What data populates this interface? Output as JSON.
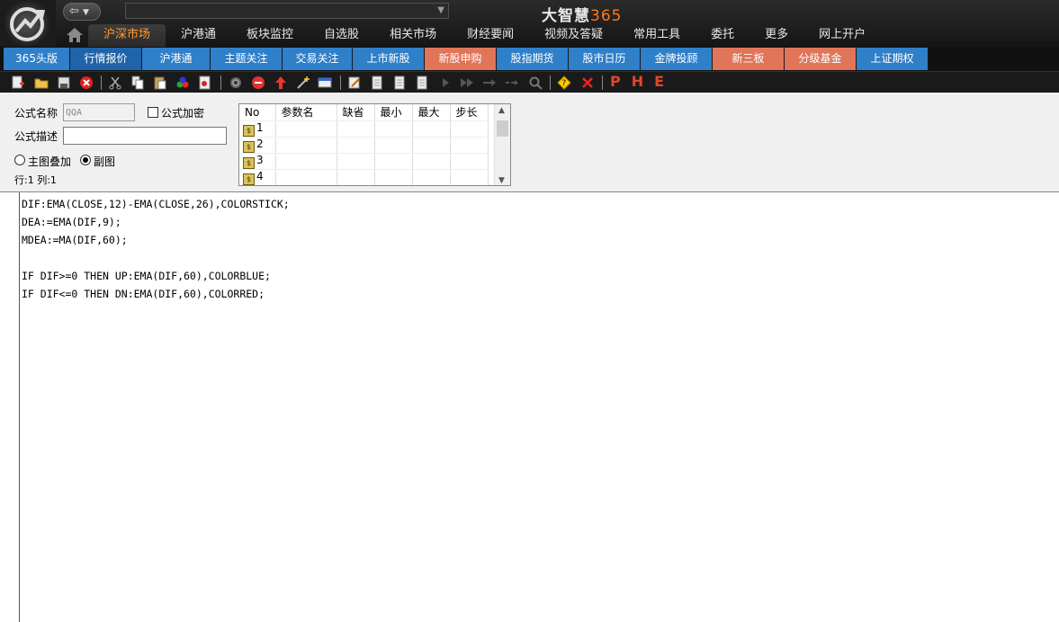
{
  "app": {
    "brand_text": "大智慧",
    "brand_num": "365",
    "colors": {
      "accent_orange": "#ff9a2e",
      "tab_blue": "#2f7fc9",
      "tab_orange": "#e0755a",
      "brand_num": "#ff7a1a"
    }
  },
  "main_nav": [
    "沪深市场",
    "沪港通",
    "板块监控",
    "自选股",
    "相关市场",
    "财经要闻",
    "视频及答疑",
    "常用工具",
    "委托",
    "更多",
    "网上开户"
  ],
  "sub_nav": [
    {
      "label": "365头版",
      "style": "blue"
    },
    {
      "label": "行情报价",
      "style": "dark"
    },
    {
      "label": "沪港通",
      "style": "blue"
    },
    {
      "label": "主题关注",
      "style": "blue"
    },
    {
      "label": "交易关注",
      "style": "blue"
    },
    {
      "label": "上市新股",
      "style": "blue"
    },
    {
      "label": "新股申购",
      "style": "orange"
    },
    {
      "label": "股指期货",
      "style": "blue"
    },
    {
      "label": "股市日历",
      "style": "blue"
    },
    {
      "label": "金牌投顾",
      "style": "blue"
    },
    {
      "label": "新三板",
      "style": "orange"
    },
    {
      "label": "分级基金",
      "style": "orange"
    },
    {
      "label": "上证期权",
      "style": "blue"
    }
  ],
  "toolbar_letters": [
    "P",
    "H",
    "E"
  ],
  "form": {
    "name_label": "公式名称",
    "name_value": "QQA",
    "encrypt_label": "公式加密",
    "desc_label": "公式描述",
    "desc_value": "",
    "radio_main": "主图叠加",
    "radio_sub": "副图",
    "cursor_pos": "行:1 列:1"
  },
  "param_table": {
    "headers": [
      "No",
      "参数名",
      "缺省",
      "最小",
      "最大",
      "步长"
    ],
    "rows": [
      "1",
      "2",
      "3",
      "4"
    ]
  },
  "code_lines": [
    "DIF:EMA(CLOSE,12)-EMA(CLOSE,26),COLORSTICK;",
    "DEA:=EMA(DIF,9);",
    "MDEA:=MA(DIF,60);",
    "",
    "IF DIF>=0 THEN UP:EMA(DIF,60),COLORBLUE;",
    "IF DIF<=0 THEN DN:EMA(DIF,60),COLORRED;"
  ]
}
